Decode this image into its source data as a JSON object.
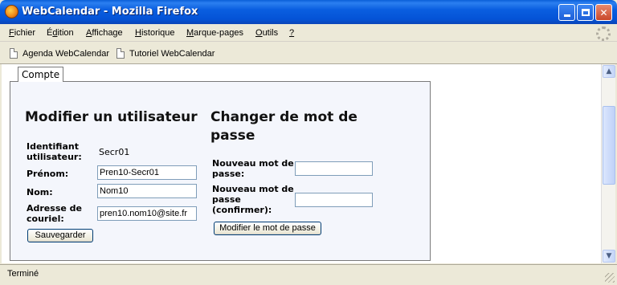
{
  "window": {
    "title": "WebCalendar - Mozilla Firefox"
  },
  "menu": {
    "fichier": {
      "u": "F",
      "rest": "ichier"
    },
    "edition": {
      "pre": "É",
      "u": "d",
      "rest": "ition"
    },
    "affichage": {
      "u": "A",
      "rest": "ffichage"
    },
    "historique": {
      "u": "H",
      "rest": "istorique"
    },
    "marque": {
      "u": "M",
      "rest": "arque-pages"
    },
    "outils": {
      "u": "O",
      "rest": "utils"
    },
    "help": {
      "u": "?"
    }
  },
  "bookmarks": [
    "Agenda WebCalendar",
    "Tutoriel WebCalendar"
  ],
  "tab": {
    "label": "Compte"
  },
  "left": {
    "heading": "Modifier un utilisateur",
    "username_label_1": "Identifiant",
    "username_label_2": "utilisateur:",
    "username_value": "Secr01",
    "firstname_label": "Prénom:",
    "firstname_value": "Pren10-Secr01",
    "lastname_label": "Nom:",
    "lastname_value": "Nom10",
    "email_label_1": "Adresse de",
    "email_label_2": "couriel:",
    "email_value": "pren10.nom10@site.fr",
    "save_label": "Sauvegarder"
  },
  "right": {
    "heading_1": "Changer de mot de",
    "heading_2": "passe",
    "new_label_1": "Nouveau mot de",
    "new_label_2": "passe:",
    "new_value": "",
    "confirm_label_1": "Nouveau mot de",
    "confirm_label_2": "passe",
    "confirm_label_3": "(confirmer):",
    "confirm_value": "",
    "change_label": "Modifier le mot de passe"
  },
  "status": {
    "text": "Terminé"
  },
  "icons": {
    "app": "firefox-icon",
    "minimize": "minimize-icon",
    "maximize": "maximize-icon",
    "close": "close-icon",
    "throbber": "throbber-icon",
    "bookmark": "page-icon",
    "scroll_up": "chevron-up-icon",
    "scroll_down": "chevron-down-icon"
  }
}
